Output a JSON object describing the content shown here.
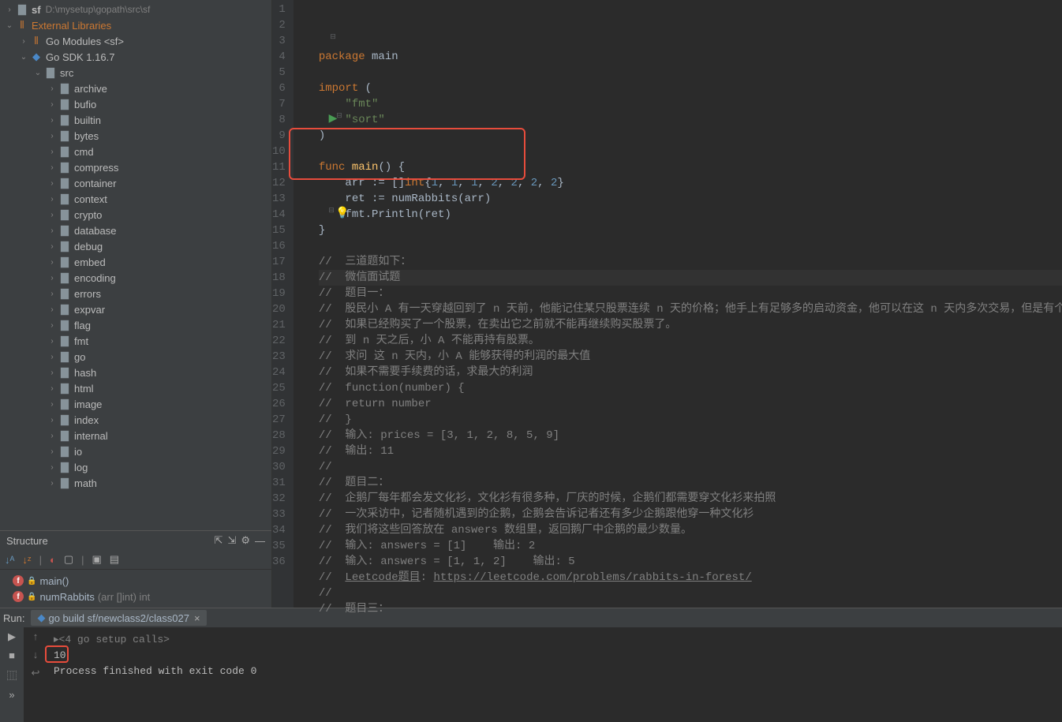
{
  "project": {
    "root_label": "sf",
    "root_path": "D:\\mysetup\\gopath\\src\\sf",
    "ext_lib_label": "External Libraries",
    "go_modules_label": "Go Modules <sf>",
    "go_sdk_label": "Go SDK 1.16.7",
    "src_label": "src",
    "folders": [
      "archive",
      "bufio",
      "builtin",
      "bytes",
      "cmd",
      "compress",
      "container",
      "context",
      "crypto",
      "database",
      "debug",
      "embed",
      "encoding",
      "errors",
      "expvar",
      "flag",
      "fmt",
      "go",
      "hash",
      "html",
      "image",
      "index",
      "internal",
      "io",
      "log",
      "math"
    ]
  },
  "structure": {
    "title": "Structure",
    "items": [
      {
        "name": "main()",
        "sig": ""
      },
      {
        "name": "numRabbits",
        "sig": "(arr []int) int"
      }
    ]
  },
  "editor": {
    "lines": [
      {
        "n": 1,
        "html": "<span class='kw'>package</span> main"
      },
      {
        "n": 2,
        "html": ""
      },
      {
        "n": 3,
        "html": "<span class='kw'>import</span> ("
      },
      {
        "n": 4,
        "html": "    <span class='str'>\"fmt\"</span>"
      },
      {
        "n": 5,
        "html": "    <span class='str'>\"sort\"</span>"
      },
      {
        "n": 6,
        "html": ")"
      },
      {
        "n": 7,
        "html": ""
      },
      {
        "n": 8,
        "html": "<span class='kw'>func</span> <span class='fn'>main</span>() {"
      },
      {
        "n": 9,
        "html": "    arr := []<span class='typ'>int</span>{<span class='num'>1</span>, <span class='num'>1</span>, <span class='num'>1</span>, <span class='num'>2</span>, <span class='num'>2</span>, <span class='num'>2</span>, <span class='num'>2</span>}"
      },
      {
        "n": 10,
        "html": "    ret := numRabbits(arr)"
      },
      {
        "n": 11,
        "html": "    fmt.Println(ret)"
      },
      {
        "n": 12,
        "html": "}"
      },
      {
        "n": 13,
        "html": ""
      },
      {
        "n": 14,
        "html": "<span class='cmt'>//  三道题如下：</span>"
      },
      {
        "n": 15,
        "html": "<span class='cmt'>//  微信面试题</span>",
        "hl": true
      },
      {
        "n": 16,
        "html": "<span class='cmt'>//  题目一：</span>"
      },
      {
        "n": 17,
        "html": "<span class='cmt'>//  股民小 A 有一天穿越回到了 n 天前，他能记住某只股票连续 n 天的价格；他手上有足够多的启动资金，他可以在这 n 天内多次交易，但是有个限制</span>"
      },
      {
        "n": 18,
        "html": "<span class='cmt'>//  如果已经购买了一个股票，在卖出它之前就不能再继续购买股票了。</span>"
      },
      {
        "n": 19,
        "html": "<span class='cmt'>//  到 n 天之后，小 A 不能再持有股票。</span>"
      },
      {
        "n": 20,
        "html": "<span class='cmt'>//  求问 这 n 天内，小 A 能够获得的利润的最大值</span>"
      },
      {
        "n": 21,
        "html": "<span class='cmt'>//  如果不需要手续费的话，求最大的利润</span>"
      },
      {
        "n": 22,
        "html": "<span class='cmt'>//  function(number) {</span>"
      },
      {
        "n": 23,
        "html": "<span class='cmt'>//  return number</span>"
      },
      {
        "n": 24,
        "html": "<span class='cmt'>//  }</span>"
      },
      {
        "n": 25,
        "html": "<span class='cmt'>//  输入: prices = [3, 1, 2, 8, 5, 9]</span>"
      },
      {
        "n": 26,
        "html": "<span class='cmt'>//  输出: 11</span>"
      },
      {
        "n": 27,
        "html": "<span class='cmt'>//</span>"
      },
      {
        "n": 28,
        "html": "<span class='cmt'>//  题目二：</span>"
      },
      {
        "n": 29,
        "html": "<span class='cmt'>//  企鹅厂每年都会发文化衫，文化衫有很多种，厂庆的时候，企鹅们都需要穿文化衫来拍照</span>"
      },
      {
        "n": 30,
        "html": "<span class='cmt'>//  一次采访中，记者随机遇到的企鹅，企鹅会告诉记者还有多少企鹅跟他穿一种文化衫</span>"
      },
      {
        "n": 31,
        "html": "<span class='cmt'>//  我们将这些回答放在 answers 数组里，返回鹅厂中企鹅的最少数量。</span>"
      },
      {
        "n": 32,
        "html": "<span class='cmt'>//  输入: answers = [1]    输出: 2</span>"
      },
      {
        "n": 33,
        "html": "<span class='cmt'>//  输入: answers = [1, 1, 2]    输出: 5</span>"
      },
      {
        "n": 34,
        "html": "<span class='cmt'>//  <u>Leetcode题目</u>: <u>https://leetcode.com/problems/rabbits-in-forest/</u></span>"
      },
      {
        "n": 35,
        "html": "<span class='cmt'>//</span>"
      },
      {
        "n": 36,
        "html": "<span class='cmt'>//  题目三：</span>"
      }
    ]
  },
  "run": {
    "label": "Run:",
    "tab": "go build sf/newclass2/class027",
    "console": [
      {
        "text": "▸<4 go setup calls>",
        "dim": true
      },
      {
        "text": "10",
        "red": true
      },
      {
        "text": ""
      },
      {
        "text": "Process finished with exit code 0"
      }
    ]
  }
}
